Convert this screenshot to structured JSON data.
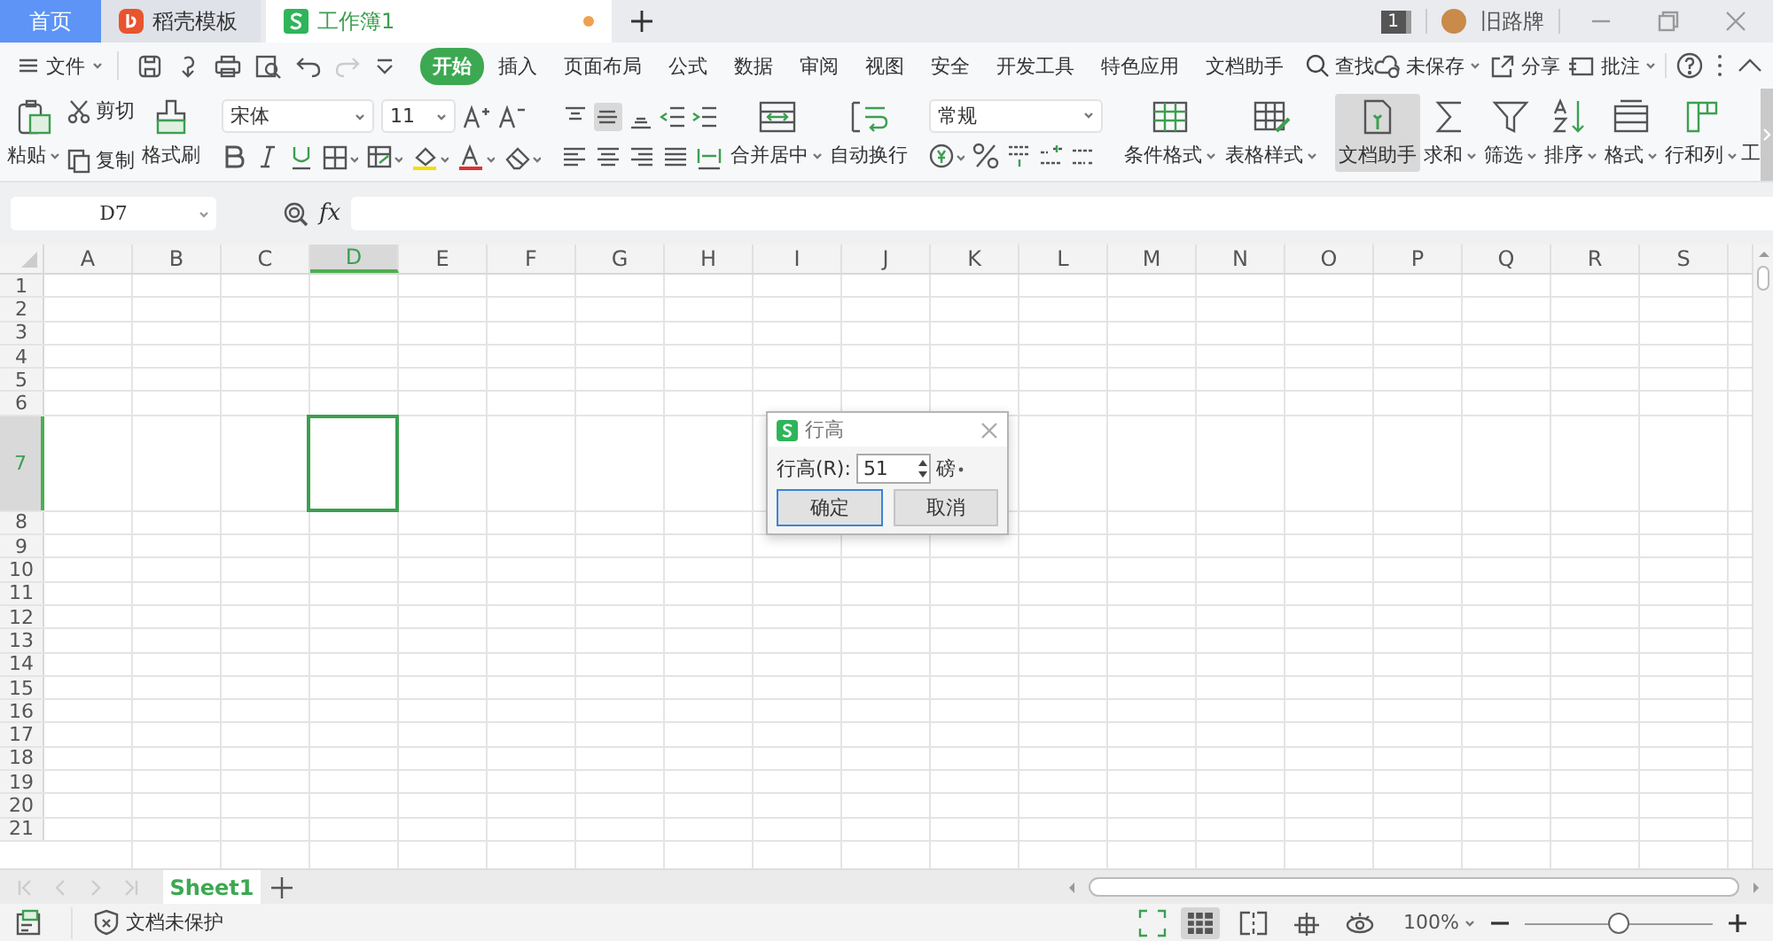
{
  "tabs": [
    {
      "label": "首页",
      "kind": "home",
      "selected": false
    },
    {
      "label": "稻壳模板",
      "kind": "docer",
      "selected": false
    },
    {
      "label": "工作簿1",
      "kind": "workbook",
      "selected": true,
      "modified": true
    }
  ],
  "account": {
    "badge": "1",
    "user": "旧路牌"
  },
  "menu": {
    "file": "文件",
    "tabs": [
      {
        "label": "开始",
        "selected": true
      },
      {
        "label": "插入",
        "selected": false
      },
      {
        "label": "页面布局",
        "selected": false
      },
      {
        "label": "公式",
        "selected": false
      },
      {
        "label": "数据",
        "selected": false
      },
      {
        "label": "审阅",
        "selected": false
      },
      {
        "label": "视图",
        "selected": false
      },
      {
        "label": "安全",
        "selected": false
      },
      {
        "label": "开发工具",
        "selected": false
      },
      {
        "label": "特色应用",
        "selected": false
      },
      {
        "label": "文档助手",
        "selected": false
      }
    ],
    "search": "查找",
    "actions": [
      {
        "label": "未保存",
        "kind": "cloud",
        "dropdown": true
      },
      {
        "label": "分享",
        "kind": "share",
        "dropdown": false
      },
      {
        "label": "批注",
        "kind": "comment",
        "dropdown": true
      }
    ]
  },
  "ribbon": {
    "paste": "粘贴",
    "cut": "剪切",
    "copy": "复制",
    "format_painter": "格式刷",
    "font": "宋体",
    "font_size": "11",
    "merge": "合并居中",
    "wrap": "自动换行",
    "number_format": "常规",
    "table_tools": [
      {
        "label": "条件格式",
        "kind": "conditional",
        "dropdown": true,
        "selected": false
      },
      {
        "label": "表格样式",
        "kind": "table_style",
        "dropdown": true,
        "selected": false
      }
    ],
    "tools": [
      {
        "label": "文档助手",
        "kind": "assistant",
        "dropdown": false,
        "selected": true
      },
      {
        "label": "求和",
        "kind": "sum",
        "dropdown": true,
        "selected": false
      },
      {
        "label": "筛选",
        "kind": "filter",
        "dropdown": true,
        "selected": false
      },
      {
        "label": "排序",
        "kind": "sort",
        "dropdown": true,
        "selected": false
      },
      {
        "label": "格式",
        "kind": "format",
        "dropdown": true,
        "selected": false
      },
      {
        "label": "行和列",
        "kind": "rows_cols",
        "dropdown": true,
        "selected": false
      },
      {
        "label": "工",
        "kind": "partial",
        "dropdown": false,
        "selected": false
      }
    ]
  },
  "formula_bar": {
    "name_box": "D7",
    "fx": "fx"
  },
  "grid": {
    "columns": [
      {
        "label": "A",
        "selected": false
      },
      {
        "label": "B",
        "selected": false
      },
      {
        "label": "C",
        "selected": false
      },
      {
        "label": "D",
        "selected": true
      },
      {
        "label": "E",
        "selected": false
      },
      {
        "label": "F",
        "selected": false
      },
      {
        "label": "G",
        "selected": false
      },
      {
        "label": "H",
        "selected": false
      },
      {
        "label": "I",
        "selected": false
      },
      {
        "label": "J",
        "selected": false
      },
      {
        "label": "K",
        "selected": false
      },
      {
        "label": "L",
        "selected": false
      },
      {
        "label": "M",
        "selected": false
      },
      {
        "label": "N",
        "selected": false
      },
      {
        "label": "O",
        "selected": false
      },
      {
        "label": "P",
        "selected": false
      },
      {
        "label": "Q",
        "selected": false
      },
      {
        "label": "R",
        "selected": false
      },
      {
        "label": "S",
        "selected": false
      }
    ],
    "rows": [
      {
        "label": "1",
        "kind": "normal",
        "selected": false
      },
      {
        "label": "2",
        "kind": "normal",
        "selected": false
      },
      {
        "label": "3",
        "kind": "normal",
        "selected": false
      },
      {
        "label": "4",
        "kind": "normal",
        "selected": false
      },
      {
        "label": "5",
        "kind": "normal",
        "selected": false
      },
      {
        "label": "6",
        "kind": "normal",
        "selected": false
      },
      {
        "label": "7",
        "kind": "tall",
        "selected": true
      },
      {
        "label": "8",
        "kind": "normal",
        "selected": false
      },
      {
        "label": "9",
        "kind": "normal",
        "selected": false
      },
      {
        "label": "10",
        "kind": "normal",
        "selected": false
      },
      {
        "label": "11",
        "kind": "normal",
        "selected": false
      },
      {
        "label": "12",
        "kind": "normal",
        "selected": false
      },
      {
        "label": "13",
        "kind": "normal",
        "selected": false
      },
      {
        "label": "14",
        "kind": "normal",
        "selected": false
      },
      {
        "label": "15",
        "kind": "normal",
        "selected": false
      },
      {
        "label": "16",
        "kind": "normal",
        "selected": false
      },
      {
        "label": "17",
        "kind": "normal",
        "selected": false
      },
      {
        "label": "18",
        "kind": "normal",
        "selected": false
      },
      {
        "label": "19",
        "kind": "normal",
        "selected": false
      },
      {
        "label": "20",
        "kind": "normal",
        "selected": false
      },
      {
        "label": "21",
        "kind": "normal",
        "selected": false
      }
    ]
  },
  "dialog": {
    "title": "行高",
    "label": "行高(R):",
    "value": "51",
    "unit": "磅",
    "buttons": [
      {
        "label": "确定",
        "default": true
      },
      {
        "label": "取消",
        "default": false
      }
    ]
  },
  "sheets": [
    {
      "label": "Sheet1",
      "selected": true
    }
  ],
  "status_bar": {
    "protection": "文档未保护",
    "views": [
      {
        "kind": "normal",
        "selected": true
      },
      {
        "kind": "page_break",
        "selected": false
      },
      {
        "kind": "reading",
        "selected": false
      },
      {
        "kind": "eye",
        "selected": false
      }
    ],
    "zoom": "100%",
    "zoom_level": {
      "level": 0.5
    }
  }
}
